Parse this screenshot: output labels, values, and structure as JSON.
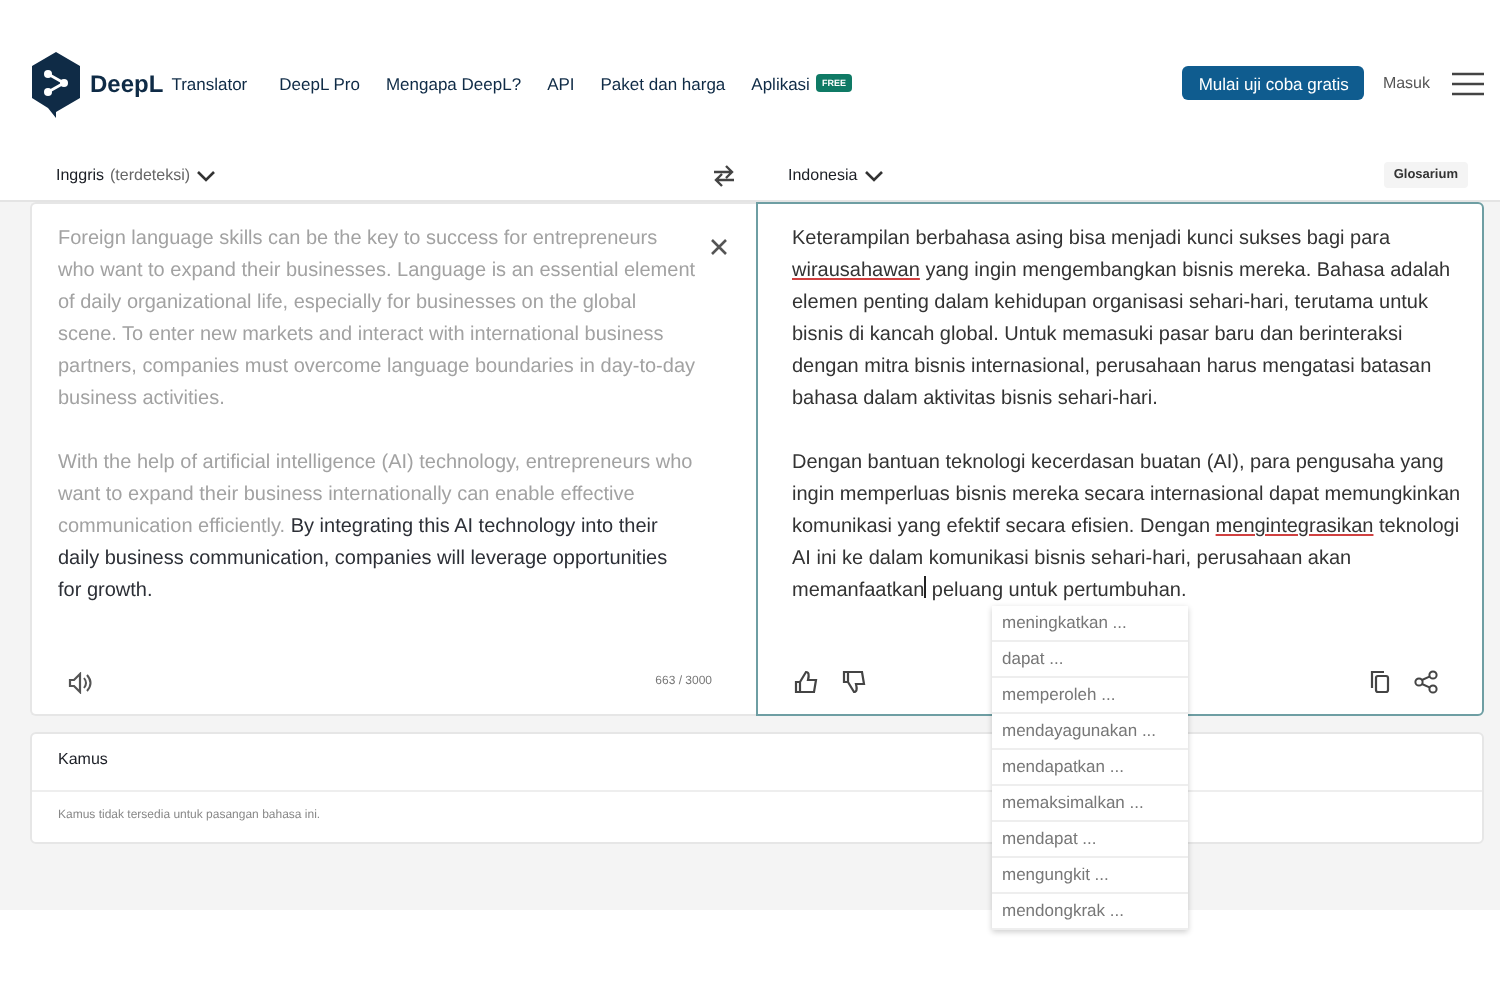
{
  "header": {
    "logo": "DeepL",
    "product": "Translator",
    "nav": [
      {
        "label": "DeepL Pro"
      },
      {
        "label": "Mengapa DeepL?"
      },
      {
        "label": "API"
      },
      {
        "label": "Paket dan harga"
      },
      {
        "label": "Aplikasi",
        "badge": "FREE"
      }
    ],
    "cta": "Mulai uji coba gratis",
    "login": "Masuk"
  },
  "source": {
    "language": "Inggris",
    "detected": "(terdeteksi)",
    "paragraphs": [
      [
        {
          "text": "Foreign language skills can be the key to success for entrepreneurs who want to expand their businesses. Language is an essential element of daily organizational life, especially for businesses on the global scene. To enter new markets and interact with international business partners, companies must overcome language boundaries in day-to-day business activities.",
          "active": false
        }
      ],
      [
        {
          "text": "With the help of artificial intelligence (AI) technology, entrepreneurs who want to expand their business internationally can enable effective communication efficiently. ",
          "active": false
        },
        {
          "text": "By integrating this AI technology into their daily business communication, companies will leverage opportunities for growth.",
          "active": true
        }
      ]
    ],
    "count": "663 / 3000"
  },
  "target": {
    "language": "Indonesia",
    "glossary": "Glosarium",
    "paragraphs": [
      [
        {
          "kind": "text",
          "text": "Keterampilan berbahasa asing bisa menjadi kunci sukses bagi para "
        },
        {
          "kind": "flagged",
          "text": "wirausahawan"
        },
        {
          "kind": "text",
          "text": " yang ingin mengembangkan bisnis mereka. Bahasa adalah elemen penting dalam kehidupan organisasi sehari-hari, terutama untuk bisnis di kancah global. Untuk memasuki pasar baru dan berinteraksi dengan mitra bisnis internasional, perusahaan harus mengatasi batasan bahasa dalam aktivitas bisnis sehari-hari."
        }
      ],
      [
        {
          "kind": "text",
          "text": "Dengan bantuan teknologi kecerdasan buatan (AI), para pengusaha yang ingin memperluas bisnis mereka secara internasional dapat memungkinkan komunikasi yang efektif secara efisien. Dengan "
        },
        {
          "kind": "flagged",
          "text": "mengintegrasikan"
        },
        {
          "kind": "text",
          "text": " teknologi AI ini ke dalam komunikasi bisnis sehari-hari, perusahaan akan memanfaatkan"
        },
        {
          "kind": "cursor"
        },
        {
          "kind": "text",
          "text": " peluang untuk pertumbuhan."
        }
      ]
    ],
    "alternatives": [
      "meningkatkan ...",
      "dapat ...",
      "memperoleh ...",
      "mendayagunakan ...",
      "mendapatkan ...",
      "memaksimalkan ...",
      "mendapat ...",
      "mengungkit ...",
      "mendongkrak ..."
    ]
  },
  "dictionary": {
    "title": "Kamus",
    "message": "Kamus tidak tersedia untuk pasangan bahasa ini."
  }
}
